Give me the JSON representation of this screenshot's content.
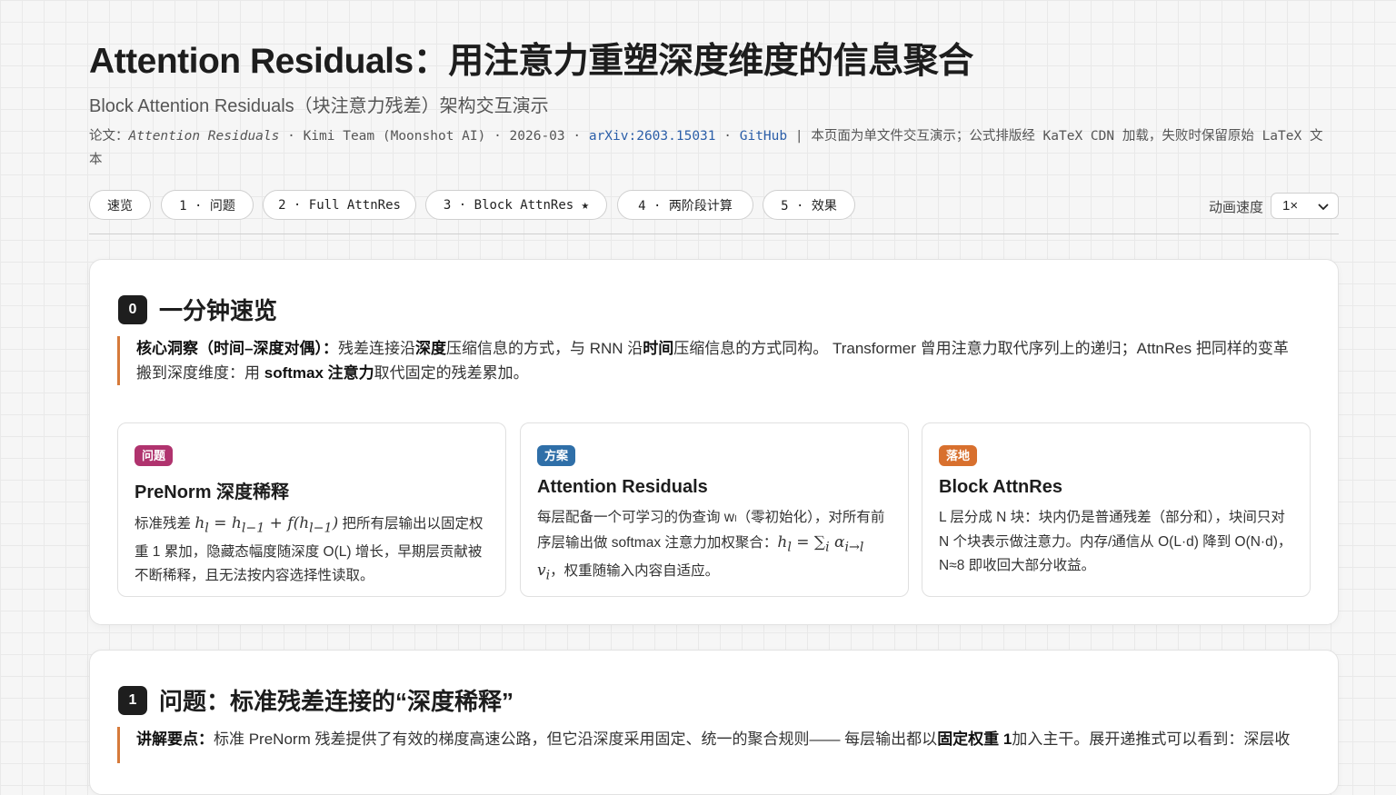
{
  "header": {
    "title": "Attention Residuals：用注意力重塑深度维度的信息聚合",
    "subtitle": "Block Attention Residuals（块注意力残差）架构交互演示",
    "meta": {
      "prefix": "论文：",
      "paper_title": "Attention Residuals",
      "authors": " · Kimi Team (Moonshot AI) · 2026-03 · ",
      "arxiv_label": "arXiv:2603.15031",
      "sep": " · ",
      "github_label": "GitHub",
      "note": " | 本页面为单文件交互演示；公式排版经 KaTeX CDN 加载，失败时保留原始 LaTeX 文本"
    }
  },
  "nav": {
    "tabs": [
      {
        "label": "速览"
      },
      {
        "label": "1 · 问题"
      },
      {
        "label": "2 · Full AttnRes"
      },
      {
        "label": "3 · Block AttnRes ★"
      },
      {
        "label": "4 · 两阶段计算"
      },
      {
        "label": "5 · 效果"
      }
    ],
    "speed_label": "动画速度",
    "speed_value": "1×"
  },
  "sections": [
    {
      "num": "0",
      "title": "一分钟速览",
      "callout": {
        "lead": "核心洞察（时间–深度对偶）：",
        "t1": "残差连接沿",
        "b1": "深度",
        "t2": "压缩信息的方式，与 RNN 沿",
        "b2": "时间",
        "t3": "压缩信息的方式同构。 Transformer 曾用注意力取代序列上的递归；AttnRes 把同样的变革搬到深度维度：用 ",
        "b3": "softmax 注意力",
        "t4": "取代固定的残差累加。"
      },
      "cards": [
        {
          "badge": "问题",
          "badge_color": "#b0336e",
          "title": "PreNorm 深度稀释",
          "pre": "标准残差 ",
          "formula": "h_l = h_{l−1} + f(h_{l−1})",
          "post": " 把所有层输出以固定权重 1 累加，隐藏态幅度随深度 O(L) 增长，早期层贡献被不断稀释，且无法按内容选择性读取。"
        },
        {
          "badge": "方案",
          "badge_color": "#2f6fa8",
          "title": "Attention Residuals",
          "pre": "每层配备一个可学习的伪查询 wₗ（零初始化），对所有前序层输出做 softmax 注意力加权聚合：",
          "formula": "h_l = ∑_i α_{i→l} v_i",
          "post": "，权重随输入内容自适应。"
        },
        {
          "badge": "落地",
          "badge_color": "#d8702e",
          "title": "Block AttnRes",
          "pre": "L 层分成 N 块：块内仍是普通残差（部分和），块间只对 N 个块表示做注意力。内存/通信从 O(L·d) 降到 O(N·d)，N≈8 即收回大部分收益。",
          "formula": "",
          "post": ""
        }
      ]
    },
    {
      "num": "1",
      "title": "问题：标准残差连接的“深度稀释”",
      "callout": {
        "lead": "讲解要点：",
        "t1": "标准 PreNorm 残差提供了有效的梯度高速公路，但它沿深度采用固定、统一的聚合规则—— 每层输出都以",
        "b1": "固定权重 1",
        "t2": "加入主干。展开递推式可以看到：深层收"
      }
    }
  ]
}
